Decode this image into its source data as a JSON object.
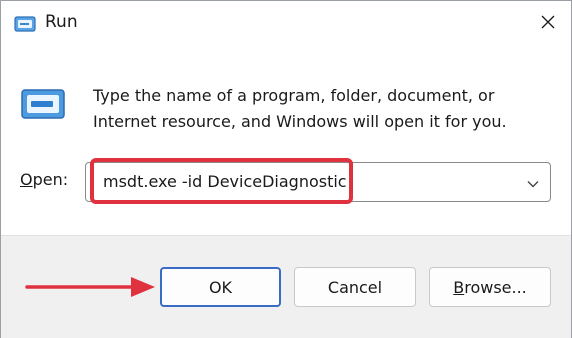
{
  "window": {
    "title": "Run"
  },
  "icons": {
    "app": "run-app-icon",
    "close": "close-icon",
    "dialog": "run-dialog-icon",
    "dropdown": "chevron-down-icon",
    "annotation_arrow": "red-arrow-annotation"
  },
  "description": {
    "line1": "Type the name of a program, folder, document, or",
    "line2": "Internet resource, and Windows will open it for you."
  },
  "open_field": {
    "label_first": "O",
    "label_rest": "pen:",
    "value": "msdt.exe -id DeviceDiagnostic"
  },
  "buttons": {
    "ok": "OK",
    "cancel": "Cancel",
    "browse_first": "B",
    "browse_rest": "rowse..."
  },
  "colors": {
    "highlight": "#e0323e",
    "ok_border": "#3a6cc6",
    "footer_bg": "#f0f0f0"
  }
}
